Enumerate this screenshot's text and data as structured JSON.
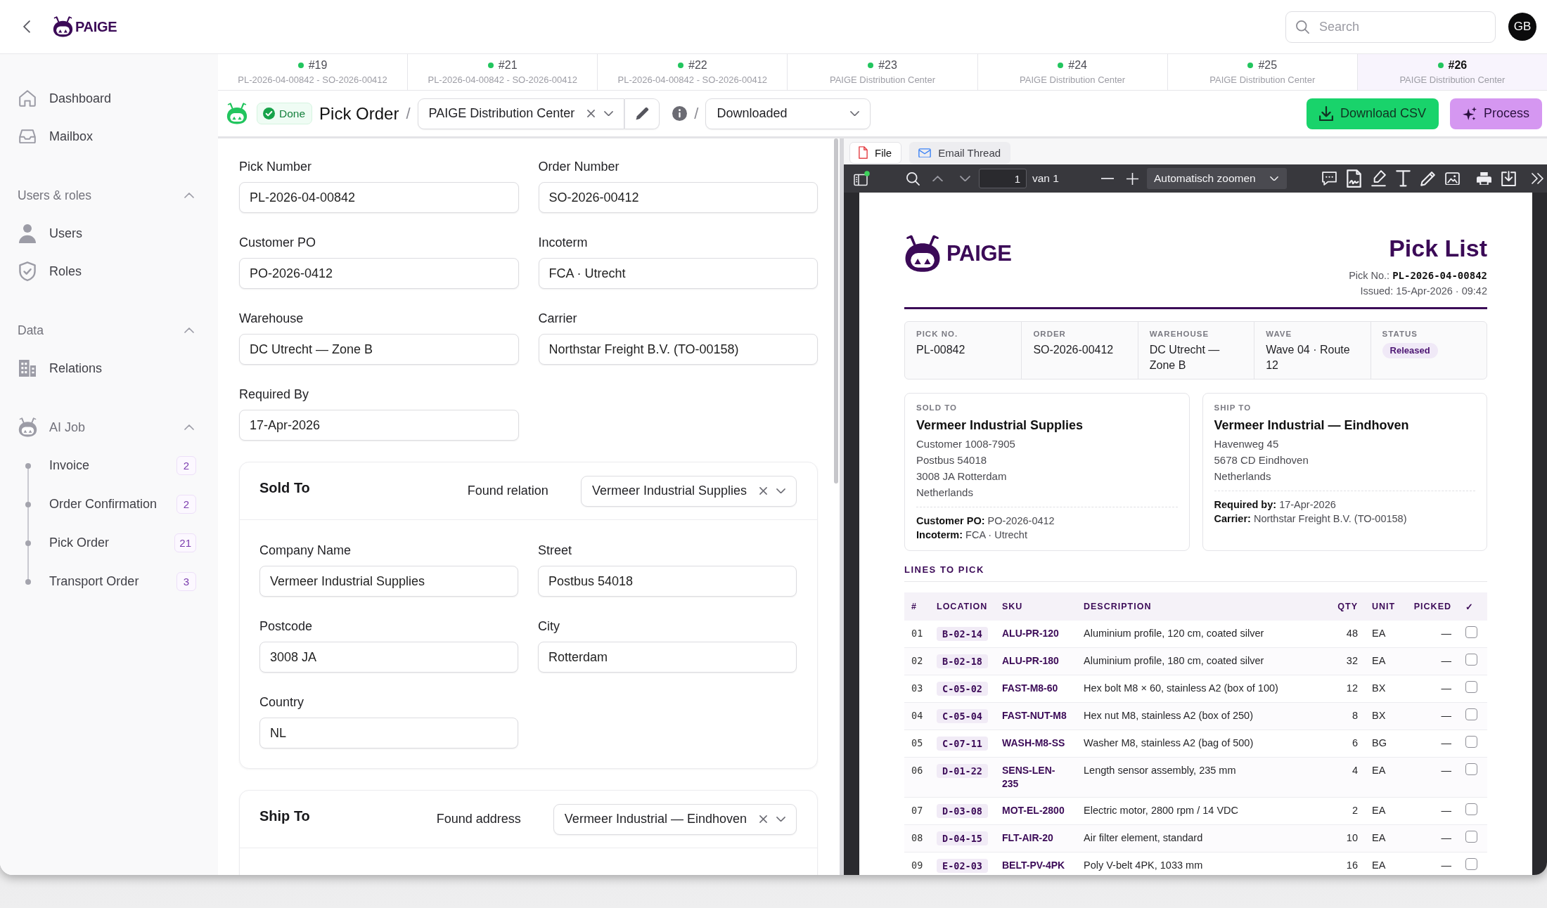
{
  "app_bar": {
    "logo_text": "PAIGE",
    "search": {
      "placeholder": "Search"
    },
    "avatar_initials": "GB"
  },
  "sidebar": {
    "items": [
      {
        "label": "Dashboard"
      },
      {
        "label": "Mailbox"
      }
    ],
    "groups": [
      {
        "title": "Users & roles",
        "expanded": true,
        "items": [
          {
            "label": "Users"
          },
          {
            "label": "Roles"
          }
        ]
      },
      {
        "title": "Data",
        "expanded": true,
        "items": [
          {
            "label": "Relations"
          }
        ]
      }
    ],
    "ai_job": {
      "title": "AI Job",
      "expanded": true,
      "items": [
        {
          "label": "Invoice",
          "count": "2"
        },
        {
          "label": "Order Confirmation",
          "count": "2"
        },
        {
          "label": "Pick Order",
          "count": "21"
        },
        {
          "label": "Transport Order",
          "count": "3"
        }
      ]
    }
  },
  "document_tabs": [
    {
      "number": "#19",
      "subtitle": "PL-2026-04-00842 - SO-2026-00412",
      "selected": false
    },
    {
      "number": "#21",
      "subtitle": "PL-2026-04-00842 - SO-2026-00412",
      "selected": false
    },
    {
      "number": "#22",
      "subtitle": "PL-2026-04-00842 - SO-2026-00412",
      "selected": false
    },
    {
      "number": "#23",
      "subtitle": "PAIGE Distribution Center",
      "selected": false
    },
    {
      "number": "#24",
      "subtitle": "PAIGE Distribution Center",
      "selected": false
    },
    {
      "number": "#25",
      "subtitle": "PAIGE Distribution Center",
      "selected": false
    },
    {
      "number": "#26",
      "subtitle": "PAIGE Distribution Center",
      "selected": true
    }
  ],
  "header": {
    "status_badge": "Done",
    "title": "Pick Order",
    "crumbs": [
      {
        "separator": "/",
        "kind": "location",
        "value": "PAIGE Distribution Center"
      },
      {
        "separator": "/",
        "kind": "status",
        "value": "Downloaded"
      }
    ],
    "buttons": [
      {
        "label": "Download CSV",
        "kind": "download"
      },
      {
        "label": "Process",
        "kind": "process"
      }
    ]
  },
  "form": {
    "fields": [
      {
        "label": "Pick Number",
        "value": "PL-2026-04-00842"
      },
      {
        "label": "Order Number",
        "value": "SO-2026-00412"
      },
      {
        "label": "Customer PO",
        "value": "PO-2026-0412"
      },
      {
        "label": "Incoterm",
        "value": "FCA · Utrecht"
      },
      {
        "label": "Warehouse",
        "value": "DC Utrecht — Zone B"
      },
      {
        "label": "Carrier",
        "value": "Northstar Freight B.V. (TO-00158)"
      },
      {
        "label": "Required By",
        "value": "17-Apr-2026"
      }
    ],
    "sections": [
      {
        "title": "Sold To",
        "match_label": "Found relation",
        "match_value": "Vermeer Industrial Supplies",
        "fields": [
          {
            "label": "Company Name",
            "value": "Vermeer Industrial Supplies"
          },
          {
            "label": "Street",
            "value": "Postbus 54018"
          },
          {
            "label": "Postcode",
            "value": "3008 JA"
          },
          {
            "label": "City",
            "value": "Rotterdam"
          },
          {
            "label": "Country",
            "value": "NL"
          }
        ]
      },
      {
        "title": "Ship To",
        "match_label": "Found address",
        "match_value": "Vermeer Industrial — Eindhoven"
      }
    ]
  },
  "viewer": {
    "tabs": [
      {
        "label": "File",
        "kind": "file",
        "selected": true
      },
      {
        "label": "Email Thread",
        "kind": "email",
        "selected": false
      }
    ],
    "toolbar": {
      "page": "1",
      "page_count": "van 1",
      "zoom": "Automatisch zoomen"
    },
    "document": {
      "logo_text": "PAIGE",
      "title": "Pick List",
      "pick_no_label": "Pick No.:",
      "pick_no": "PL-2026-04-00842",
      "issued": "Issued: 15-Apr-2026 · 09:42",
      "summary": [
        {
          "label": "PICK NO.",
          "value": "PL-00842",
          "kind": "text"
        },
        {
          "label": "ORDER",
          "value": "SO-2026-00412",
          "kind": "text"
        },
        {
          "label": "WAREHOUSE",
          "value": "DC Utrecht — Zone B",
          "kind": "text"
        },
        {
          "label": "WAVE",
          "value": "Wave 04 · Route 12",
          "kind": "text"
        },
        {
          "label": "STATUS",
          "value": "Released",
          "kind": "badge"
        }
      ],
      "parties": [
        {
          "label": "SOLD TO",
          "name": "Vermeer Industrial Supplies",
          "lines": [
            "Customer 1008-7905",
            "Postbus 54018",
            "3008 JA Rotterdam",
            "Netherlands"
          ],
          "notes": [
            "**Customer PO:** PO-2026-0412",
            "**Incoterm:** FCA · Utrecht"
          ]
        },
        {
          "label": "SHIP TO",
          "name": "Vermeer Industrial — Eindhoven",
          "lines": [
            "Havenweg 45",
            "5678 CD Eindhoven",
            "Netherlands"
          ],
          "notes": [
            "**Required by:** 17-Apr-2026",
            "**Carrier:** Northstar Freight B.V. (TO-00158)"
          ]
        }
      ],
      "lines_title": "LINES TO PICK",
      "columns": [
        "#",
        "LOCATION",
        "SKU",
        "DESCRIPTION",
        "QTY",
        "UNIT",
        "PICKED",
        "✓"
      ],
      "rows": [
        {
          "no": "01",
          "location": "B-02-14",
          "sku": "ALU-PR-120",
          "description": "Aluminium profile, 120 cm, coated silver",
          "qty": "48",
          "unit": "EA",
          "picked": "—",
          "checked": false
        },
        {
          "no": "02",
          "location": "B-02-18",
          "sku": "ALU-PR-180",
          "description": "Aluminium profile, 180 cm, coated silver",
          "qty": "32",
          "unit": "EA",
          "picked": "—",
          "checked": false
        },
        {
          "no": "03",
          "location": "C-05-02",
          "sku": "FAST-M8-60",
          "description": "Hex bolt M8 × 60, stainless A2 (box of 100)",
          "qty": "12",
          "unit": "BX",
          "picked": "—",
          "checked": false
        },
        {
          "no": "04",
          "location": "C-05-04",
          "sku": "FAST-NUT-M8",
          "description": "Hex nut M8, stainless A2 (box of 250)",
          "qty": "8",
          "unit": "BX",
          "picked": "—",
          "checked": false
        },
        {
          "no": "05",
          "location": "C-07-11",
          "sku": "WASH-M8-SS",
          "description": "Washer M8, stainless A2 (bag of 500)",
          "qty": "6",
          "unit": "BG",
          "picked": "—",
          "checked": false
        },
        {
          "no": "06",
          "location": "D-01-22",
          "sku": "SENS-LEN-235",
          "description": "Length sensor assembly, 235 mm",
          "qty": "4",
          "unit": "EA",
          "picked": "—",
          "checked": false
        },
        {
          "no": "07",
          "location": "D-03-08",
          "sku": "MOT-EL-2800",
          "description": "Electric motor, 2800 rpm / 14 VDC",
          "qty": "2",
          "unit": "EA",
          "picked": "—",
          "checked": false
        },
        {
          "no": "08",
          "location": "D-04-15",
          "sku": "FLT-AIR-20",
          "description": "Air filter element, standard",
          "qty": "10",
          "unit": "EA",
          "picked": "—",
          "checked": false
        },
        {
          "no": "09",
          "location": "E-02-03",
          "sku": "BELT-PV-4PK",
          "description": "Poly V-belt 4PK, 1033 mm",
          "qty": "16",
          "unit": "EA",
          "picked": "—",
          "checked": false
        }
      ]
    }
  }
}
